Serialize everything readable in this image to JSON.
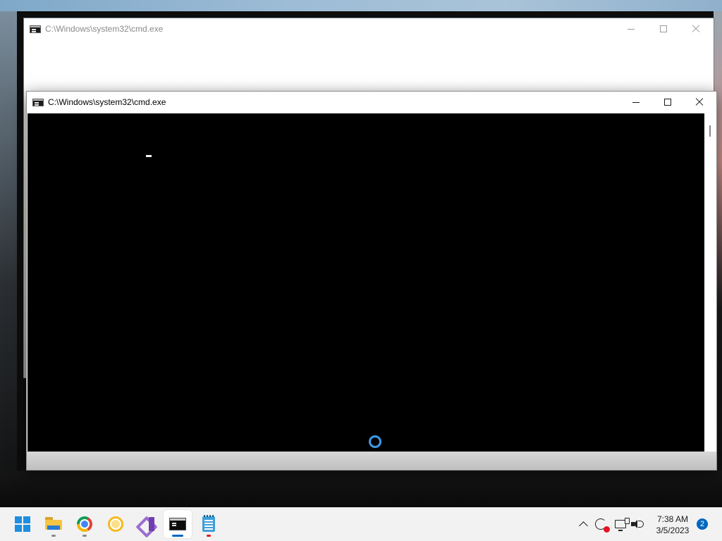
{
  "windows": {
    "back": {
      "title": "C:\\Windows\\system32\\cmd.exe",
      "icon": "cmd-icon"
    },
    "front": {
      "title": "C:\\Windows\\system32\\cmd.exe",
      "icon": "cmd-icon",
      "console_text": "",
      "busy_indicator": "loading-ring-icon"
    }
  },
  "taskbar": {
    "items": [
      {
        "name": "start-button",
        "icon": "windows-start-icon",
        "active": false,
        "running": false
      },
      {
        "name": "file-explorer",
        "icon": "folder-icon",
        "active": false,
        "running": true
      },
      {
        "name": "chrome",
        "icon": "chrome-icon",
        "active": false,
        "running": true
      },
      {
        "name": "chrome-canary",
        "icon": "chrome-canary-icon",
        "active": false,
        "running": false
      },
      {
        "name": "visual-studio",
        "icon": "visual-studio-icon",
        "active": false,
        "running": false
      },
      {
        "name": "command-prompt",
        "icon": "cmd-icon",
        "active": true,
        "running": true
      },
      {
        "name": "notepad",
        "icon": "notepad-icon",
        "active": false,
        "running": true,
        "alert": true
      }
    ],
    "tray": {
      "icons": [
        "chevron-up-icon",
        "sync-alert-icon",
        "network-icon",
        "volume-icon"
      ],
      "time": "7:38 AM",
      "date": "3/5/2023",
      "notification_count": "2"
    }
  },
  "colors": {
    "accent": "#0067c0",
    "console_bg": "#000000",
    "busy_ring": "#3d9bea",
    "alert": "#e81123"
  }
}
